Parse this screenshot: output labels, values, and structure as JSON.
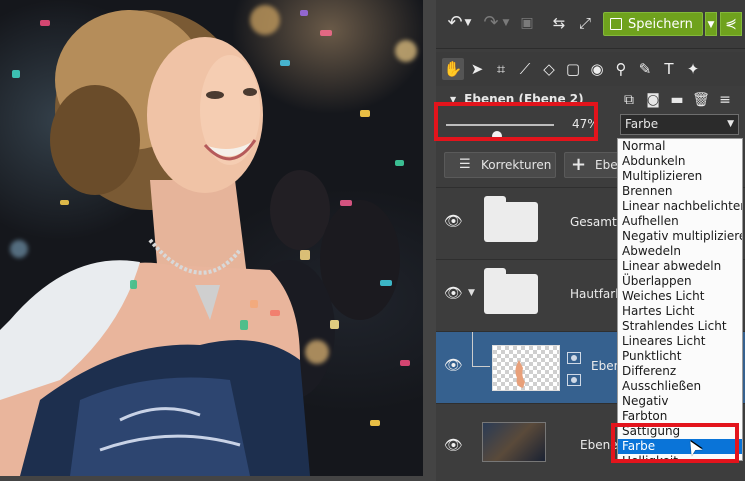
{
  "toolbar": {
    "save_label": "Speichern"
  },
  "layers_panel": {
    "title": "Ebenen (Ebene 2)",
    "opacity": {
      "value_label": "47%",
      "fraction": 0.47
    },
    "blend_mode": "Farbe",
    "korrekturen_label": "Korrekturen",
    "ebene_button_label": "Ebe",
    "layers": [
      {
        "name": "Gesamtfa"
      },
      {
        "name": "Hautfarbe"
      },
      {
        "name": "Eben"
      },
      {
        "name": "Ebene"
      }
    ]
  },
  "blend_options": [
    "Normal",
    "Abdunkeln",
    "Multiplizieren",
    "Brennen",
    "Linear nachbelichten",
    "Aufhellen",
    "Negativ multiplizieren",
    "Abwedeln",
    "Linear abwedeln",
    "Überlappen",
    "Weiches Licht",
    "Hartes Licht",
    "Strahlendes Licht",
    "Lineares Licht",
    "Punktlicht",
    "Differenz",
    "Ausschließen",
    "Negativ",
    "Farbton",
    "Sättigung",
    "Farbe",
    "Helligkeit"
  ],
  "highlighted_option": "Farbe",
  "colors": {
    "accent_green": "#6fa21d",
    "selection_blue": "#36618f",
    "list_highlight": "#0a74d8",
    "annotation_red": "#e3141c"
  }
}
